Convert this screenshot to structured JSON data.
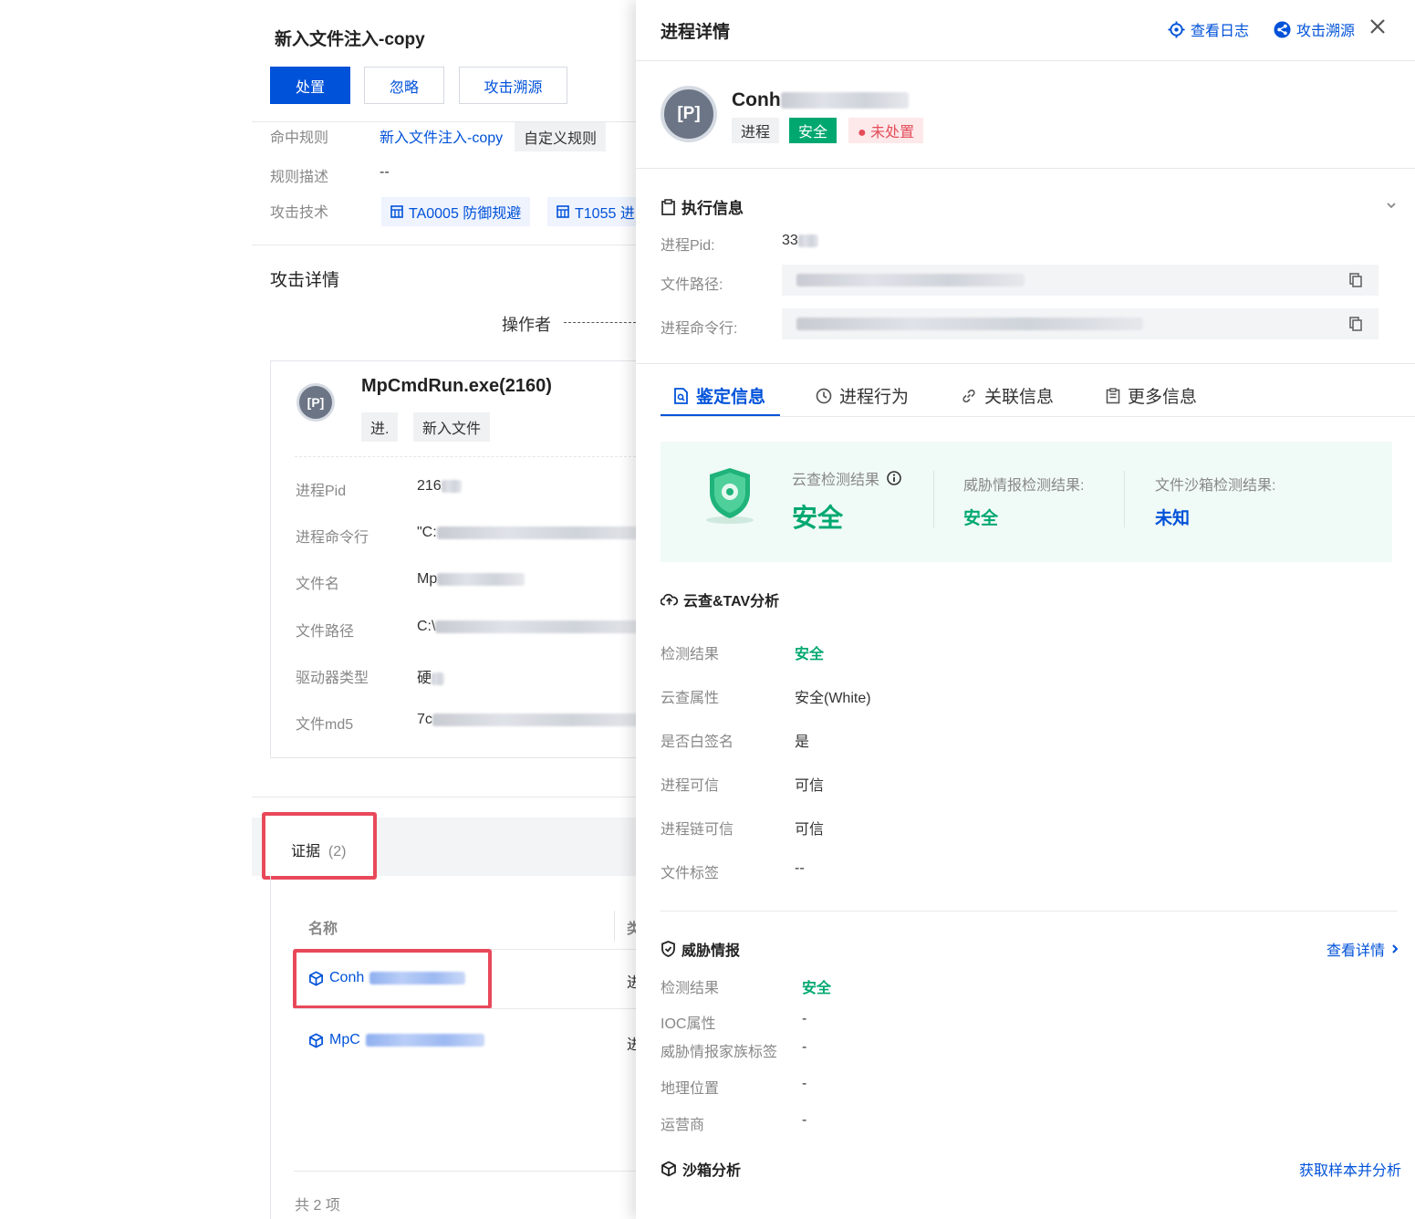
{
  "left": {
    "title": "新入文件注入-copy",
    "buttons": {
      "dispose": "处置",
      "ignore": "忽略",
      "trace": "攻击溯源"
    },
    "rule": {
      "hit_label": "命中规则",
      "hit_value": "新入文件注入-copy",
      "hit_tag": "自定义规则",
      "desc_label": "规则描述",
      "desc_value": "--",
      "tech_label": "攻击技术",
      "tech_1": "TA0005 防御规避",
      "tech_2": "T1055 进"
    },
    "attack_detail": "攻击详情",
    "operator": "操作者",
    "process": {
      "name": "MpCmdRun.exe(2160)",
      "tag_1": "进.",
      "tag_2": "新入文件",
      "rows": [
        {
          "label": "进程Pid",
          "value": "216"
        },
        {
          "label": "进程命令行",
          "value": "\"C:"
        },
        {
          "label": "文件名",
          "value": "Mp"
        },
        {
          "label": "文件路径",
          "value": "C:\\"
        },
        {
          "label": "驱动器类型",
          "value": "硬"
        },
        {
          "label": "文件md5",
          "value": "7c"
        }
      ]
    },
    "evidence": {
      "tab_label": "证据",
      "tab_count": "(2)",
      "col_name": "名称",
      "col_type": "类",
      "items": [
        {
          "name": "Conh",
          "type": "进"
        },
        {
          "name": "MpC",
          "type": "进"
        }
      ],
      "total": "共 2 项"
    }
  },
  "right": {
    "title": "进程详情",
    "view_log": "查看日志",
    "trace": "攻击溯源",
    "process_name": "Conh",
    "badges": {
      "type": "进程",
      "safe": "安全",
      "status": "未处置"
    },
    "exec": {
      "title": "执行信息",
      "pid_label": "进程Pid:",
      "pid_value": "33",
      "path_label": "文件路径:",
      "cmd_label": "进程命令行:"
    },
    "tabs": {
      "identify": "鉴定信息",
      "behavior": "进程行为",
      "related": "关联信息",
      "more": "更多信息"
    },
    "summary": {
      "cloud_label": "云查检测结果",
      "cloud_value": "安全",
      "intel_label": "威胁情报检测结果:",
      "intel_value": "安全",
      "sandbox_label": "文件沙箱检测结果:",
      "sandbox_value": "未知"
    },
    "tav": {
      "title": "云查&TAV分析",
      "rows": [
        {
          "label": "检测结果",
          "value": "安全"
        },
        {
          "label": "云查属性",
          "value": "安全(White)"
        },
        {
          "label": "是否白签名",
          "value": "是"
        },
        {
          "label": "进程可信",
          "value": "可信"
        },
        {
          "label": "进程链可信",
          "value": "可信"
        },
        {
          "label": "文件标签",
          "value": "--"
        }
      ]
    },
    "intel": {
      "title": "威胁情报",
      "link": "查看详情",
      "rows": [
        {
          "label": "检测结果",
          "value": "安全"
        },
        {
          "label": "IOC属性",
          "value": "-"
        },
        {
          "label": "威胁情报家族标签",
          "value": "-"
        },
        {
          "label": "地理位置",
          "value": "-"
        },
        {
          "label": "运营商",
          "value": "-"
        }
      ]
    },
    "sandbox": {
      "title": "沙箱分析",
      "link": "获取样本并分析"
    },
    "colors": {
      "brand": "#0052d9",
      "safe": "#00a870",
      "danger": "#e34d59",
      "highlight": "#e8495a"
    }
  }
}
